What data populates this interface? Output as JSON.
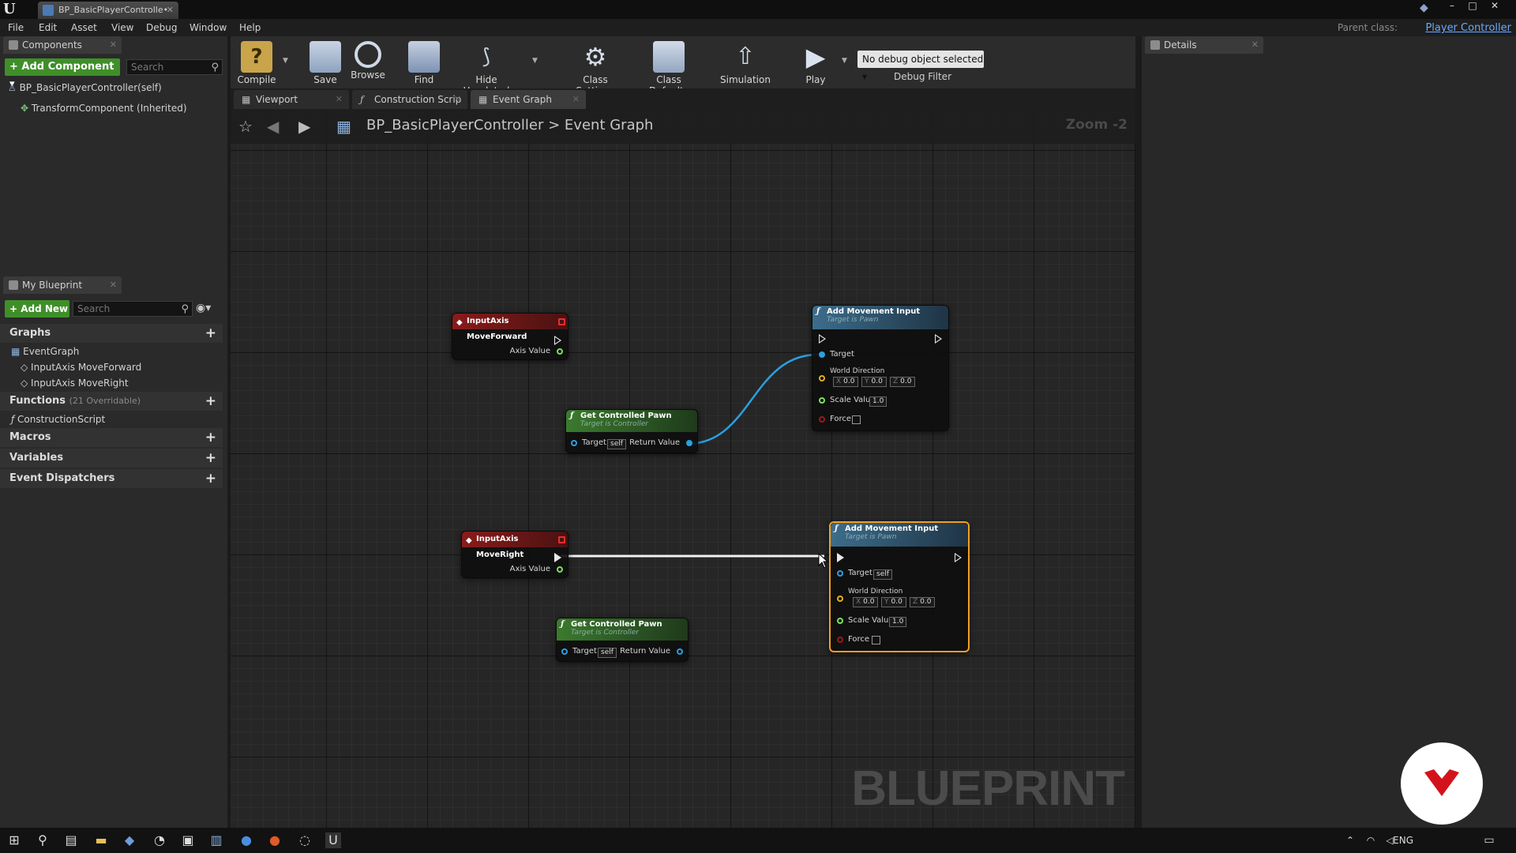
{
  "window": {
    "doc_tab_label": "BP_BasicPlayerControlle•",
    "minimize_glyph": "–",
    "maximize_glyph": "□",
    "close_glyph": "✕",
    "logo_glyph": "U"
  },
  "menu": [
    "File",
    "Edit",
    "Asset",
    "View",
    "Debug",
    "Window",
    "Help"
  ],
  "parent_class": {
    "label": "Parent class:",
    "value": "Player Controller"
  },
  "components_panel": {
    "tab_label": "Components",
    "add_button": "+ Add Component ▾",
    "search_placeholder": "Search",
    "items": [
      "BP_BasicPlayerController(self)",
      "TransformComponent (Inherited)"
    ]
  },
  "my_blueprint_panel": {
    "tab_label": "My Blueprint",
    "add_new": "+ Add New ▾",
    "search_placeholder": "Search",
    "sections": {
      "graphs": "Graphs",
      "functions": "Functions",
      "functions_sub": "(21 Overridable)",
      "macros": "Macros",
      "variables": "Variables",
      "event_dispatchers": "Event Dispatchers"
    },
    "graph_items": [
      "EventGraph",
      "InputAxis MoveForward",
      "InputAxis MoveRight"
    ],
    "function_items": [
      "ConstructionScript"
    ]
  },
  "toolbar": {
    "buttons": [
      "Compile",
      "Save",
      "Browse",
      "Find",
      "Hide Unrelated",
      "Class Settings",
      "Class Defaults",
      "Simulation",
      "Play"
    ],
    "debug_select": "No debug object selected ▾",
    "debug_filter": "Debug Filter"
  },
  "graph_tabs": [
    "Viewport",
    "Construction Scrip",
    "Event Graph"
  ],
  "graph": {
    "breadcrumb": "BP_BasicPlayerController  >  Event Graph",
    "zoom": "Zoom -2",
    "watermark": "BLUEPRINT"
  },
  "nodes": {
    "input_forward": {
      "title": "InputAxis MoveForward",
      "pin_axis": "Axis Value"
    },
    "input_right": {
      "title": "InputAxis MoveRight",
      "pin_axis": "Axis Value"
    },
    "get_pawn_1": {
      "title": "Get Controlled Pawn",
      "subtitle": "Target is Controller",
      "pin_target": "Target",
      "target_value": "self",
      "pin_return": "Return Value"
    },
    "get_pawn_2": {
      "title": "Get Controlled Pawn",
      "subtitle": "Target is Controller",
      "pin_target": "Target",
      "target_value": "self",
      "pin_return": "Return Value"
    },
    "add_move_1": {
      "title": "Add Movement Input",
      "subtitle": "Target is Pawn",
      "pin_target": "Target",
      "pin_world": "World Direction",
      "x": "0.0",
      "y": "0.0",
      "z": "0.0",
      "pin_scale": "Scale Value",
      "scale": "1.0",
      "pin_force": "Force"
    },
    "add_move_2": {
      "title": "Add Movement Input",
      "subtitle": "Target is Pawn",
      "pin_target": "Target",
      "target_value": "self",
      "pin_world": "World Direction",
      "x": "0.0",
      "y": "0.0",
      "z": "0.0",
      "pin_scale": "Scale Value",
      "scale": "1.0",
      "pin_force": "Force"
    }
  },
  "details_panel": {
    "tab_label": "Details"
  },
  "taskbar": {
    "language": "ENG"
  },
  "colors": {
    "accent_green": "#3f8f29",
    "event_red": "#8a1b1b",
    "func_blue": "#3c6d8c",
    "pure_green": "#3b7a2e",
    "selection_orange": "#f0a020",
    "link_blue": "#6aa9ff"
  }
}
